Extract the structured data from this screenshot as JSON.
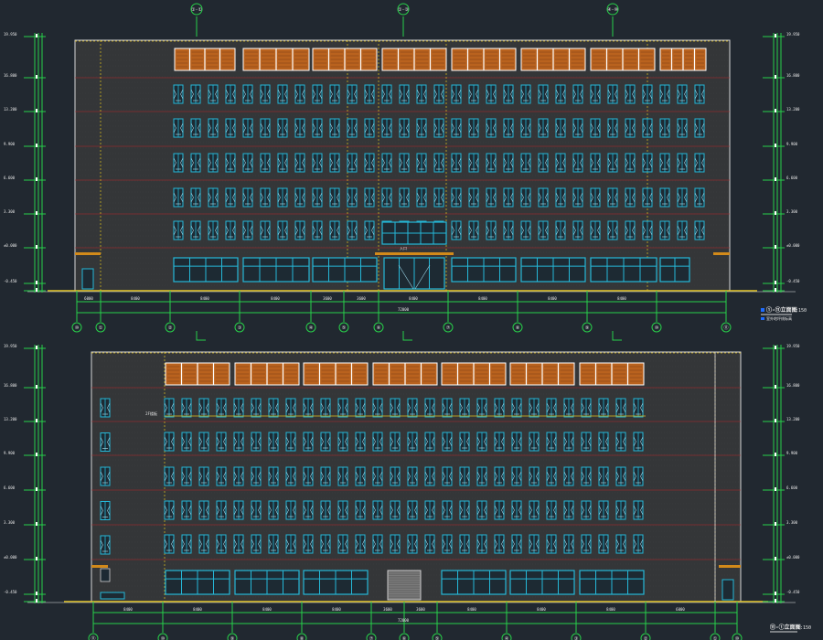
{
  "colors": {
    "background": "#212830",
    "facade_fill": "#343638",
    "outline": "#d8d8d8",
    "window_line": "#25b8d8",
    "window_glass": "#1d2a33",
    "roof_panel": "#b9621e",
    "roof_panel_dark": "#7d3f14",
    "dimension_line": "#28d04a",
    "dimension_text": "#e8e8e8",
    "yellow_line": "#e2c21c",
    "red_line": "#b8242a",
    "canopy": "#d28a1a",
    "label_box": "#1e6cff"
  },
  "drawing": {
    "top_axis_marks": [
      "①-①",
      "①-③",
      "④-⑩"
    ],
    "elevations": [
      {
        "id": "upper",
        "title": "①-⑪立面图",
        "scale": "1:150",
        "note": "室外地坪线标高",
        "total_dimension": "72000",
        "level_labels": [
          "19.950",
          "16.800",
          "13.200",
          "9.900",
          "6.600",
          "3.300",
          "±0.000",
          "-0.450"
        ],
        "axis_labels": [
          "⑩",
          "①",
          "②",
          "③",
          "④",
          "⑤",
          "⑥",
          "⑦",
          "⑧",
          "⑨",
          "⑩",
          "⑪"
        ],
        "grid_dims": [
          "6000",
          "8400",
          "8400",
          "8400",
          "3600",
          "3600",
          "8400",
          "8400",
          "8400",
          "8400"
        ],
        "entrance_label": "入口"
      },
      {
        "id": "lower",
        "title": "⑪-①立面图",
        "scale": "1:150",
        "total_dimension": "72000",
        "level_labels": [
          "19.950",
          "16.800",
          "13.200",
          "9.900",
          "6.600",
          "3.300",
          "±0.000",
          "-0.450"
        ],
        "axis_labels": [
          "⑪",
          "⑩",
          "⑨",
          "⑧",
          "⑦",
          "⑥",
          "⑤",
          "④",
          "③",
          "②",
          "①",
          "⑩"
        ],
        "grid_dims": [
          "8400",
          "8400",
          "8400",
          "8400",
          "3600",
          "3600",
          "8400",
          "8400",
          "8400",
          "6000"
        ],
        "floor_note": "2F楼板"
      }
    ]
  }
}
